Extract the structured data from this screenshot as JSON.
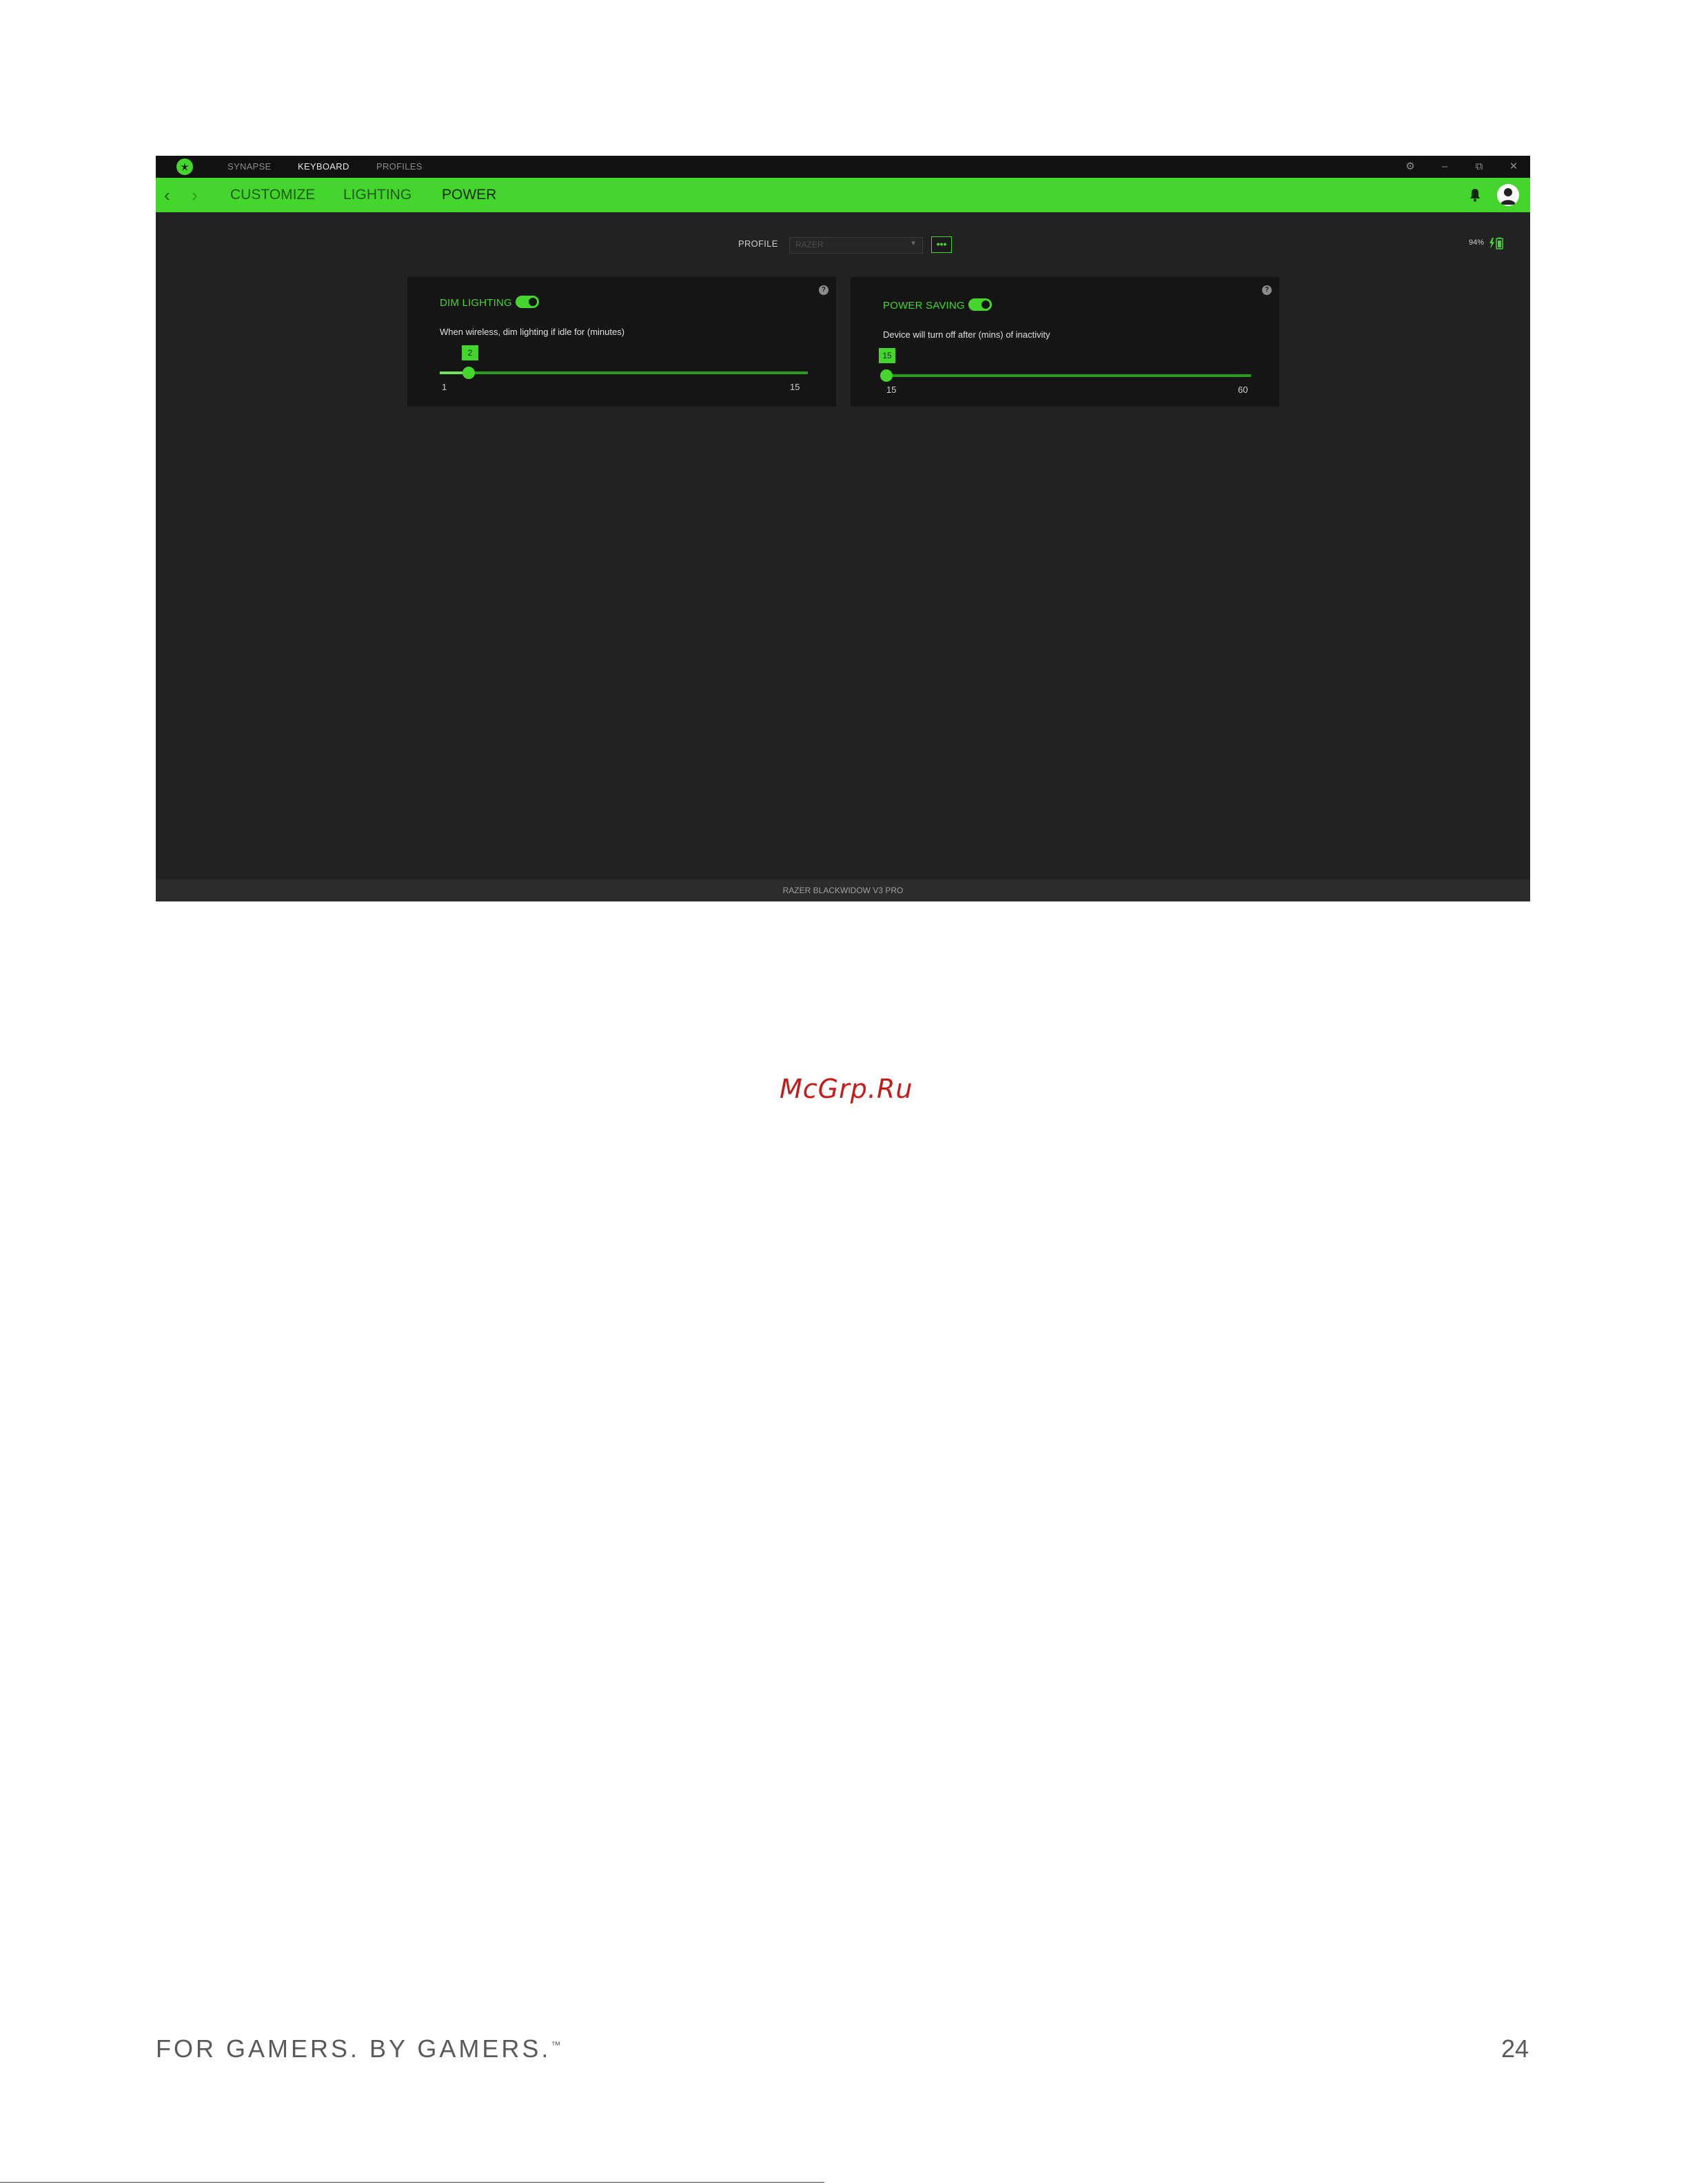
{
  "window": {
    "nav": {
      "synapse": "SYNAPSE",
      "keyboard": "KEYBOARD",
      "profiles": "PROFILES",
      "active": "KEYBOARD"
    },
    "controls": {
      "settings": "⚙",
      "minimize": "–",
      "restore": "⧉",
      "close": "✕"
    }
  },
  "subnav": {
    "back": "‹",
    "forward": "›",
    "tabs": [
      "CUSTOMIZE",
      "LIGHTING",
      "POWER"
    ],
    "active_tab": "POWER"
  },
  "profile": {
    "label": "PROFILE",
    "value": "RAZER",
    "more": "•••"
  },
  "battery": {
    "percent": "94%"
  },
  "dim_lighting": {
    "title": "DIM LIGHTING",
    "enabled": true,
    "description": "When wireless, dim lighting if idle for (minutes)",
    "value": "2",
    "min": "1",
    "max": "15",
    "help": "?"
  },
  "power_saving": {
    "title": "POWER SAVING",
    "enabled": true,
    "description": "Device will turn off after (mins) of inactivity",
    "value": "15",
    "min": "15",
    "max": "60",
    "help": "?"
  },
  "device_name": "RAZER BLACKWIDOW V3 PRO",
  "watermark": "McGrp.Ru",
  "footer": {
    "tagline": "FOR GAMERS. BY GAMERS.",
    "trademark": "™",
    "page_number": "24"
  },
  "colors": {
    "accent": "#44d62c",
    "window_bg": "#222222",
    "card_bg": "#151515",
    "titlebar_bg": "#111111"
  },
  "icons": [
    "razer-logo-icon",
    "settings-icon",
    "minimize-icon",
    "restore-icon",
    "close-icon",
    "back-arrow-icon",
    "forward-arrow-icon",
    "bell-icon",
    "user-avatar-icon",
    "battery-charging-icon",
    "help-icon"
  ]
}
